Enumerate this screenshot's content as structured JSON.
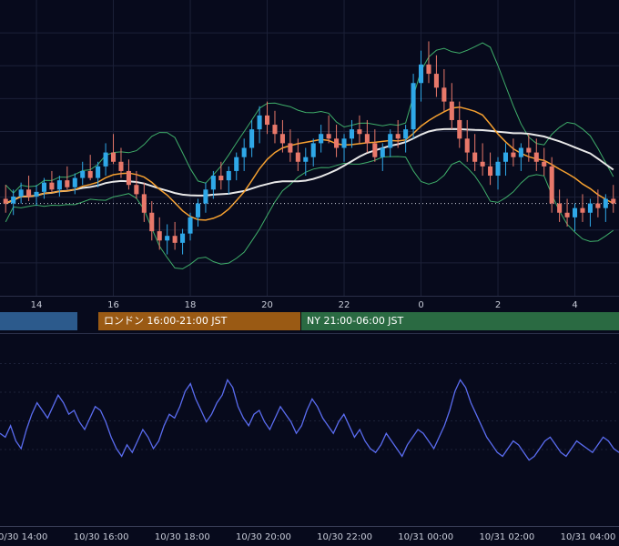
{
  "colors": {
    "background": "#070a1c",
    "grid": "#1c2138",
    "candle_up": "#2fa8e8",
    "candle_down": "#e8786a",
    "sma_short": "#f5a030",
    "sma_long": "#e8e8e8",
    "bollinger": "#3fae6a",
    "oscillator": "#5a6cf0",
    "axis_text": "#c8ccd8",
    "session_tokyo": "#2c5a8c",
    "session_london": "#9a5a14",
    "session_ny": "#2a6a42"
  },
  "sessions": [
    {
      "label": "",
      "color": "#2c5a8c"
    },
    {
      "label": "ロンドン 16:00-21:00 JST",
      "color": "#9a5a14"
    },
    {
      "label": "NY 21:00-06:00 JST",
      "color": "#2a6a42"
    }
  ],
  "chart_data": [
    {
      "type": "candlestick",
      "x_ticks": [
        "14",
        "16",
        "18",
        "20",
        "22",
        "0",
        "2",
        "4"
      ],
      "overlays": [
        "sma_short",
        "sma_long",
        "bollinger_bands"
      ],
      "grid": true,
      "ylim": [
        0,
        100
      ],
      "ohlc": [
        [
          46,
          52,
          40,
          44
        ],
        [
          44,
          50,
          39,
          47
        ],
        [
          47,
          53,
          44,
          50
        ],
        [
          50,
          56,
          45,
          47
        ],
        [
          47,
          52,
          43,
          49
        ],
        [
          49,
          55,
          46,
          53
        ],
        [
          53,
          58,
          49,
          50
        ],
        [
          50,
          56,
          47,
          54
        ],
        [
          54,
          60,
          50,
          51
        ],
        [
          51,
          57,
          48,
          55
        ],
        [
          55,
          62,
          52,
          58
        ],
        [
          58,
          65,
          54,
          55
        ],
        [
          55,
          62,
          51,
          60
        ],
        [
          60,
          70,
          56,
          66
        ],
        [
          66,
          74,
          61,
          62
        ],
        [
          62,
          68,
          55,
          58
        ],
        [
          58,
          63,
          50,
          52
        ],
        [
          52,
          58,
          46,
          48
        ],
        [
          48,
          53,
          36,
          40
        ],
        [
          40,
          45,
          28,
          32
        ],
        [
          32,
          38,
          24,
          28
        ],
        [
          28,
          35,
          22,
          30
        ],
        [
          30,
          36,
          24,
          27
        ],
        [
          27,
          33,
          22,
          31
        ],
        [
          31,
          40,
          28,
          38
        ],
        [
          38,
          46,
          34,
          44
        ],
        [
          44,
          53,
          40,
          50
        ],
        [
          50,
          58,
          46,
          56
        ],
        [
          56,
          62,
          50,
          54
        ],
        [
          54,
          60,
          48,
          58
        ],
        [
          58,
          66,
          54,
          64
        ],
        [
          64,
          72,
          58,
          68
        ],
        [
          68,
          80,
          64,
          76
        ],
        [
          76,
          86,
          70,
          82
        ],
        [
          82,
          88,
          74,
          78
        ],
        [
          78,
          84,
          70,
          74
        ],
        [
          74,
          80,
          66,
          70
        ],
        [
          70,
          76,
          62,
          66
        ],
        [
          66,
          72,
          58,
          62
        ],
        [
          62,
          68,
          56,
          64
        ],
        [
          64,
          72,
          60,
          70
        ],
        [
          70,
          78,
          66,
          74
        ],
        [
          74,
          82,
          70,
          72
        ],
        [
          72,
          78,
          64,
          68
        ],
        [
          68,
          74,
          62,
          72
        ],
        [
          72,
          80,
          68,
          76
        ],
        [
          76,
          82,
          70,
          74
        ],
        [
          74,
          80,
          66,
          70
        ],
        [
          70,
          76,
          62,
          64
        ],
        [
          64,
          70,
          58,
          68
        ],
        [
          68,
          76,
          64,
          74
        ],
        [
          74,
          80,
          68,
          72
        ],
        [
          72,
          78,
          66,
          76
        ],
        [
          76,
          100,
          72,
          96
        ],
        [
          96,
          110,
          88,
          104
        ],
        [
          104,
          114,
          96,
          100
        ],
        [
          100,
          108,
          90,
          94
        ],
        [
          94,
          102,
          84,
          88
        ],
        [
          88,
          96,
          76,
          80
        ],
        [
          80,
          88,
          68,
          72
        ],
        [
          72,
          80,
          62,
          66
        ],
        [
          66,
          74,
          58,
          62
        ],
        [
          62,
          70,
          56,
          60
        ],
        [
          60,
          66,
          52,
          56
        ],
        [
          56,
          64,
          50,
          62
        ],
        [
          62,
          70,
          56,
          66
        ],
        [
          66,
          72,
          60,
          64
        ],
        [
          64,
          70,
          58,
          68
        ],
        [
          68,
          74,
          62,
          66
        ],
        [
          66,
          72,
          58,
          62
        ],
        [
          62,
          68,
          56,
          60
        ],
        [
          60,
          64,
          40,
          44
        ],
        [
          44,
          50,
          36,
          40
        ],
        [
          40,
          46,
          34,
          38
        ],
        [
          38,
          44,
          32,
          42
        ],
        [
          42,
          48,
          36,
          40
        ],
        [
          40,
          46,
          34,
          44
        ],
        [
          44,
          50,
          38,
          42
        ],
        [
          42,
          48,
          36,
          46
        ],
        [
          46,
          52,
          40,
          44
        ]
      ]
    },
    {
      "type": "line",
      "x_ticks": [
        "10/30 14:00",
        "10/30 16:00",
        "10/30 18:00",
        "10/30 20:00",
        "10/30 22:00",
        "10/31 00:00",
        "10/31 02:00",
        "10/31 04:00"
      ],
      "grid": true,
      "ylim": [
        0,
        100
      ],
      "series": [
        {
          "values": [
            48,
            46,
            52,
            44,
            40,
            50,
            58,
            64,
            60,
            56,
            62,
            68,
            64,
            58,
            60,
            54,
            50,
            56,
            62,
            60,
            54,
            46,
            40,
            36,
            42,
            38,
            44,
            50,
            46,
            40,
            44,
            52,
            58,
            56,
            62,
            70,
            74,
            66,
            60,
            54,
            58,
            64,
            68,
            76,
            72,
            62,
            56,
            52,
            58,
            60,
            54,
            50,
            56,
            62,
            58,
            54,
            48,
            52,
            60,
            66,
            62,
            56,
            52,
            48,
            54,
            58,
            52,
            46,
            50,
            44,
            40,
            38,
            42,
            48,
            44,
            40,
            36,
            42,
            46,
            50,
            48,
            44,
            40,
            46,
            52,
            60,
            70,
            76,
            72,
            64,
            58,
            52,
            46,
            42,
            38,
            36,
            40,
            44,
            42,
            38,
            34,
            36,
            40,
            44,
            46,
            42,
            38,
            36,
            40,
            44,
            42,
            40,
            38,
            42,
            46,
            44,
            40,
            38
          ]
        }
      ]
    }
  ]
}
